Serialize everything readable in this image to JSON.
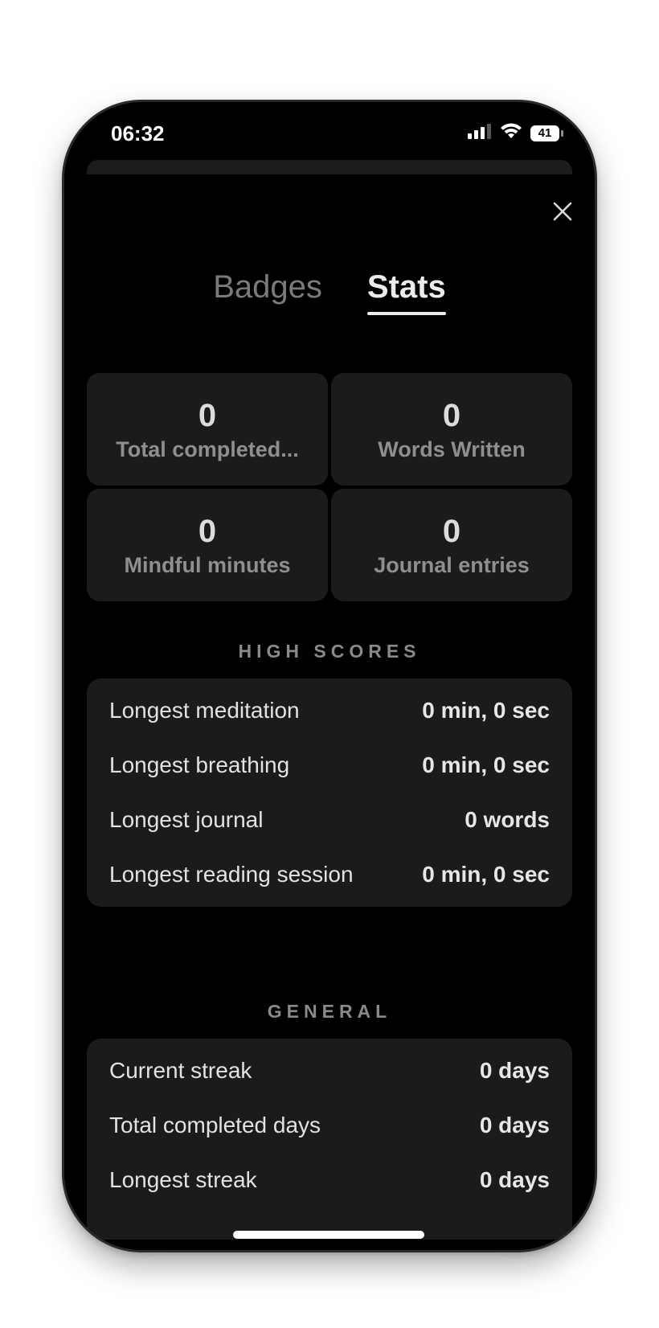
{
  "status_bar": {
    "time": "06:32",
    "battery": "41"
  },
  "tabs": [
    {
      "label": "Badges",
      "active": false
    },
    {
      "label": "Stats",
      "active": true
    }
  ],
  "stats": [
    {
      "value": "0",
      "label": "Total completed..."
    },
    {
      "value": "0",
      "label": "Words Written"
    },
    {
      "value": "0",
      "label": "Mindful minutes"
    },
    {
      "value": "0",
      "label": "Journal entries"
    }
  ],
  "high_scores": {
    "title": "HIGH SCORES",
    "rows": [
      {
        "label": "Longest meditation",
        "value": "0 min, 0 sec"
      },
      {
        "label": "Longest breathing",
        "value": "0 min, 0 sec"
      },
      {
        "label": "Longest journal",
        "value": "0 words"
      },
      {
        "label": "Longest reading session",
        "value": "0 min, 0 sec"
      }
    ]
  },
  "general": {
    "title": "GENERAL",
    "rows": [
      {
        "label": "Current streak",
        "value": "0 days"
      },
      {
        "label": "Total completed days",
        "value": "0 days"
      },
      {
        "label": "Longest streak",
        "value": "0 days"
      }
    ]
  },
  "icons": {
    "close": "close-icon",
    "signal": "cellular-signal-icon",
    "wifi": "wifi-icon",
    "battery": "battery-icon"
  }
}
